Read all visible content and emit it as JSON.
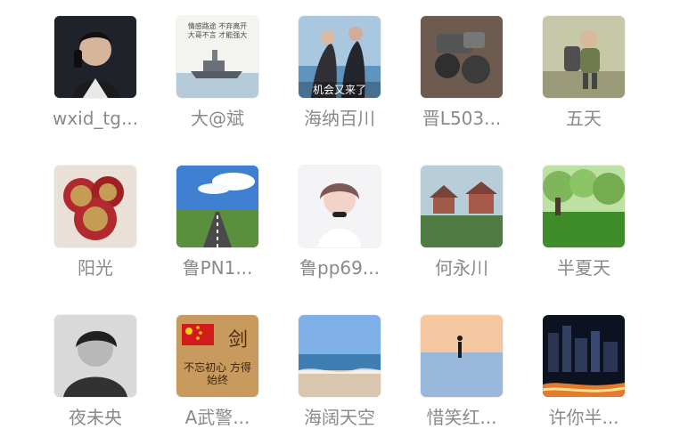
{
  "contacts": [
    {
      "name": "wxid_tg...",
      "avatar": "person-phone-avatar"
    },
    {
      "name": "大@斌",
      "avatar": "ship-text-avatar"
    },
    {
      "name": "海纳百川",
      "avatar": "couple-sea-avatar",
      "overlay_text": "机会又来了"
    },
    {
      "name": "晋L503...",
      "avatar": "machinery-avatar"
    },
    {
      "name": "五天",
      "avatar": "child-backpack-avatar"
    },
    {
      "name": "阳光",
      "avatar": "red-ornament-avatar"
    },
    {
      "name": "鲁PN1...",
      "avatar": "road-sky-avatar"
    },
    {
      "name": "鲁pp69...",
      "avatar": "girl-portrait-avatar"
    },
    {
      "name": "何永川",
      "avatar": "house-field-avatar"
    },
    {
      "name": "半夏天",
      "avatar": "green-park-avatar"
    },
    {
      "name": "夜未央",
      "avatar": "bw-person-avatar"
    },
    {
      "name": "A武警...",
      "avatar": "flag-calligraphy-avatar",
      "caption_top": "剑",
      "caption_bottom": "不忘初心 方得始终"
    },
    {
      "name": "海阔天空",
      "avatar": "sea-horizon-avatar"
    },
    {
      "name": "惜笑红...",
      "avatar": "sunset-walk-avatar"
    },
    {
      "name": "许你半...",
      "avatar": "city-night-avatar"
    }
  ],
  "ship_caption_top": "情感路途 不弃离开",
  "ship_caption_bottom": "大哥不言 才能强大"
}
